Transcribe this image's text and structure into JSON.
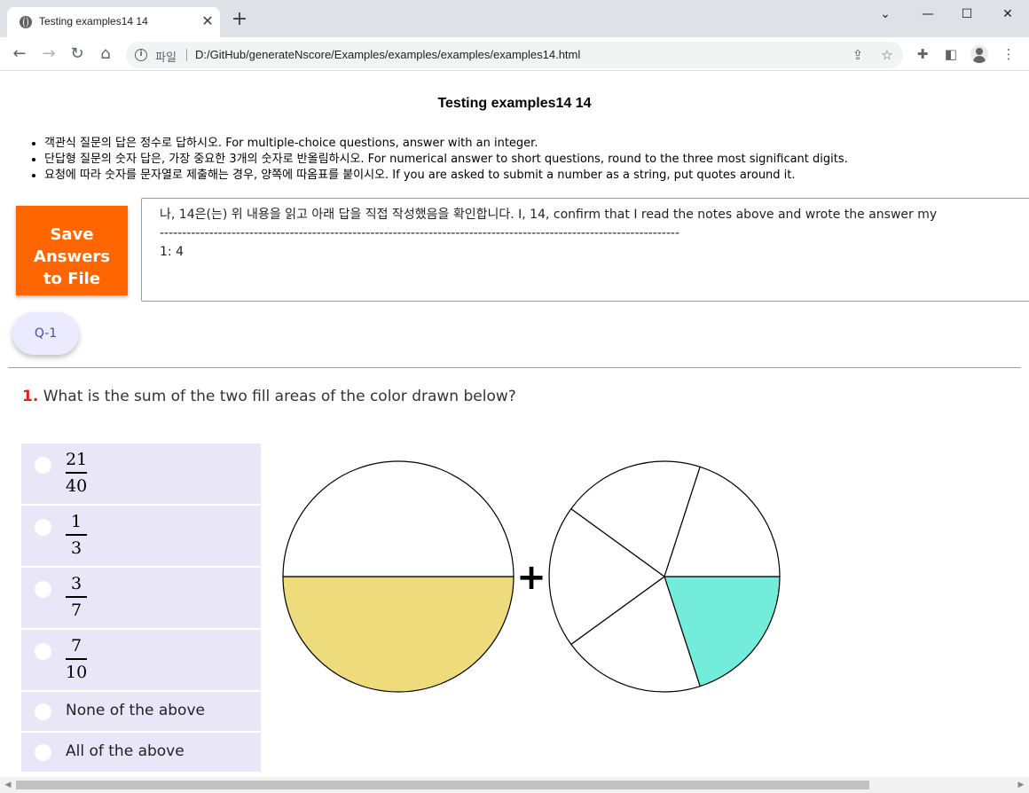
{
  "browser": {
    "tab_title": "Testing examples14 14",
    "scheme_label": "파일",
    "url": "D:/GitHub/generateNscore/Examples/examples/examples/examples14.html"
  },
  "page": {
    "title": "Testing examples14 14",
    "notes": [
      "객관식 질문의 답은 정수로 답하시오. For multiple-choice questions, answer with an integer.",
      "단답형 질문의 숫자 답은, 가장 중요한 3개의 숫자로 반올림하시오. For numerical answer to short questions, round to the three most significant digits.",
      "요청에 따라 숫자를 문자열로 제출해는 경우, 양쪽에 따옴표를 붙이시오. If you are asked to submit a number as a string, put quotes around it."
    ],
    "save_button": [
      "Save",
      "Answers",
      "to File"
    ],
    "answer_box": {
      "line1": "나, 14은(는) 위 내용을 읽고 아래 답을 직접 작성했음을 확인합니다. I, 14, confirm that I read the notes above and wrote the answer my",
      "line2": "--------------------------------------------------------------------------------------------------------------------",
      "line3": "1: 4"
    },
    "question_tab": "Q-1"
  },
  "question": {
    "number": "1.",
    "text": " What is the sum of the two fill areas of the color drawn below?",
    "choices": [
      {
        "type": "fraction",
        "numerator": "21",
        "denominator": "40"
      },
      {
        "type": "fraction",
        "numerator": "1",
        "denominator": "3"
      },
      {
        "type": "fraction",
        "numerator": "3",
        "denominator": "7"
      },
      {
        "type": "fraction",
        "numerator": "7",
        "denominator": "10"
      },
      {
        "type": "text",
        "label": "None of the above"
      },
      {
        "type": "text",
        "label": "All of the above"
      }
    ],
    "figure": {
      "operator": "+",
      "left_circle": {
        "slices": 2,
        "filled": 1,
        "fill_color": "#eedb7b"
      },
      "right_circle": {
        "slices": 5,
        "filled": 1,
        "fill_color": "#74ecdc"
      }
    }
  }
}
